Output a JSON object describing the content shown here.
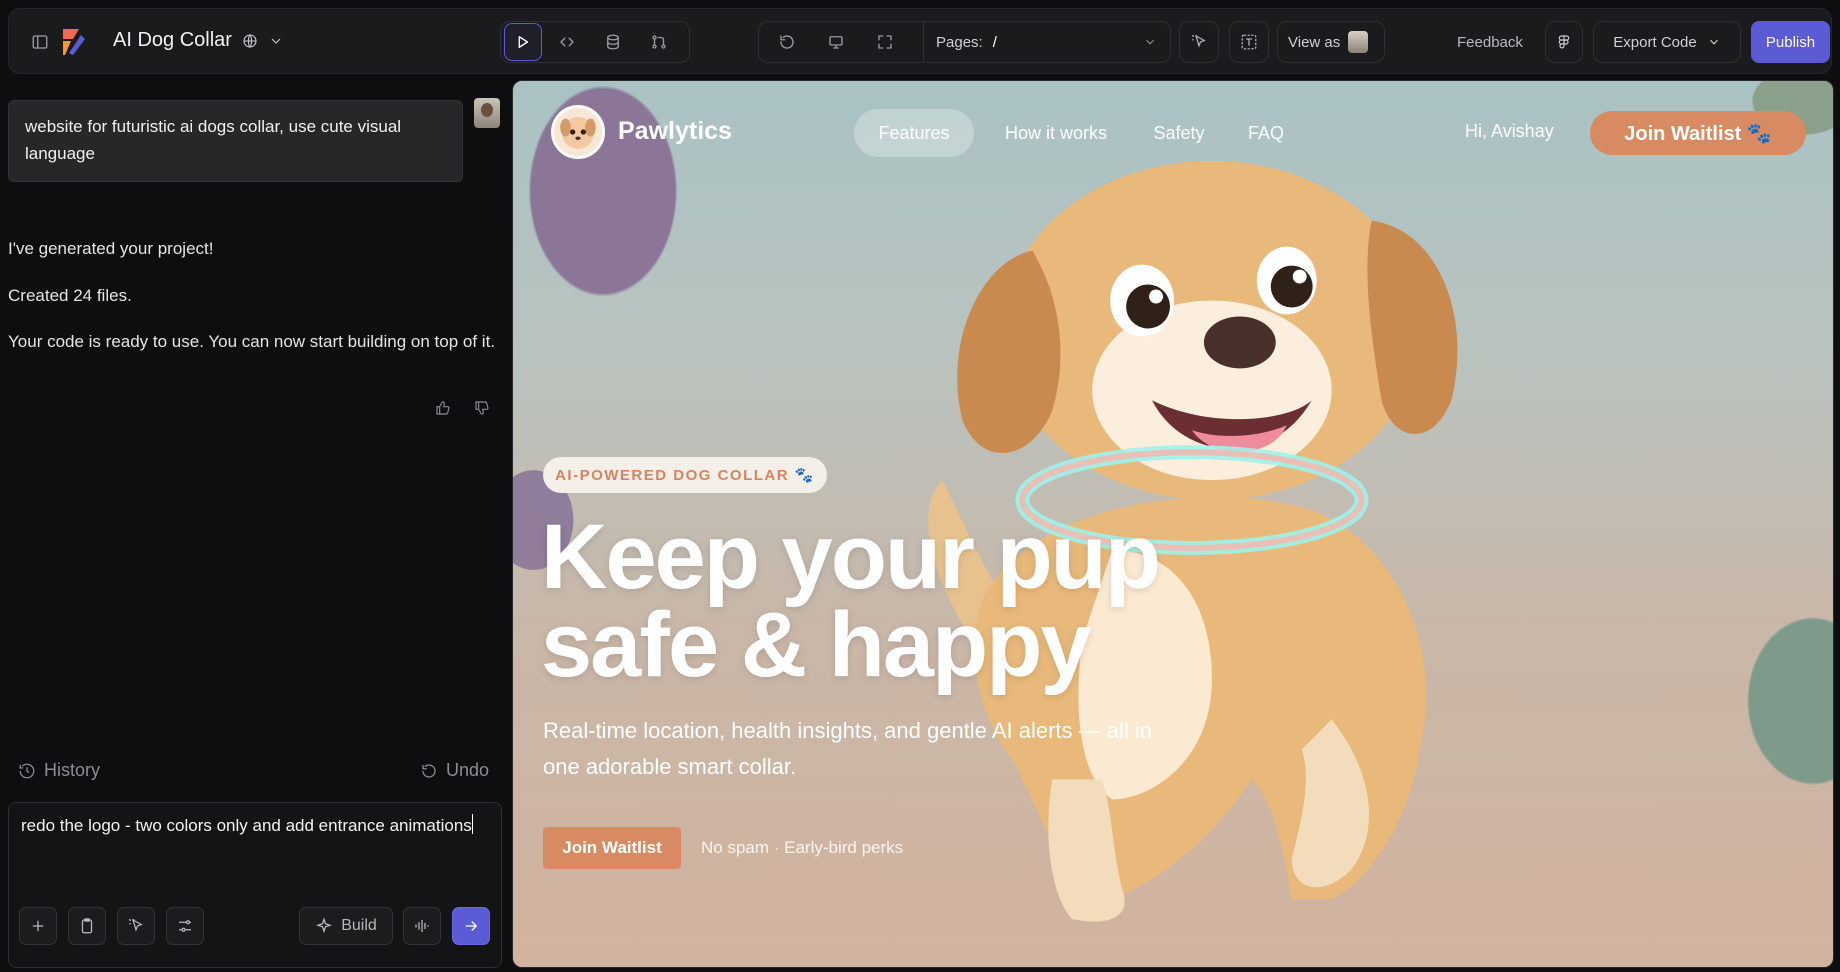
{
  "topbar": {
    "project_title": "AI Dog Collar",
    "pages_label": "Pages:",
    "pages_value": "/",
    "view_as": "View as",
    "feedback": "Feedback",
    "export": "Export Code",
    "publish": "Publish"
  },
  "chat": {
    "prompt": "website for futuristic ai dogs collar, use cute visual language",
    "messages": [
      "I've generated your project!",
      "Created 24 files.",
      "Your code is ready to use. You can now start building on top of it."
    ],
    "history": "History",
    "undo": "Undo",
    "composer_text": "redo the logo - two colors only and add entrance animations",
    "build": "Build"
  },
  "preview": {
    "brand": "Pawlytics",
    "nav": [
      "Features",
      "How it works",
      "Safety",
      "FAQ"
    ],
    "greeting": "Hi, Avishay",
    "cta_top": "Join Waitlist 🐾",
    "badge": "AI-POWERED DOG COLLAR 🐾",
    "headline_1": "Keep your pup",
    "headline_2": "safe & happy",
    "subtitle": "Real-time location, health insights, and gentle AI alerts — all in one adorable smart collar.",
    "cta_bottom": "Join Waitlist",
    "perks": "No spam · Early-bird perks"
  },
  "colors": {
    "accent": "#5b5bd6",
    "cta": "#d88a63",
    "panel": "#1b1b1e"
  }
}
